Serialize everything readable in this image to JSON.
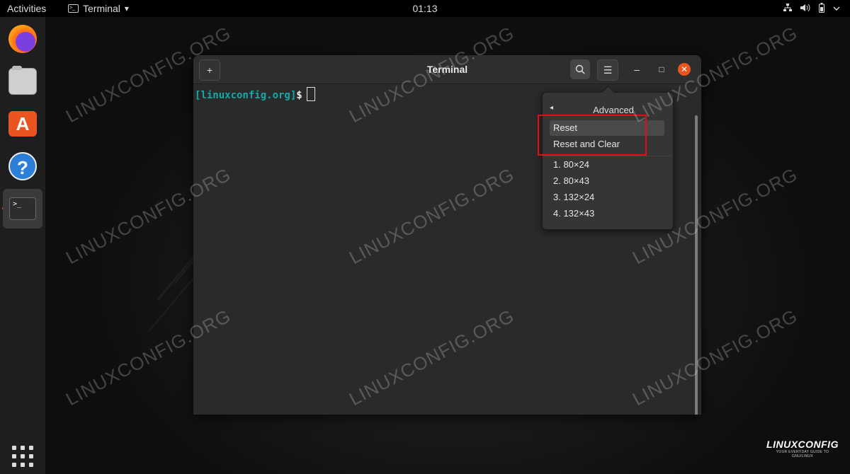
{
  "topbar": {
    "activities": "Activities",
    "app_name": "Terminal",
    "app_dropdown_icon": "▾",
    "clock": "01:13",
    "tray_icons": [
      "network-icon",
      "volume-icon",
      "battery-icon",
      "power-icon"
    ]
  },
  "dock": {
    "items": [
      {
        "name": "Firefox Web Browser",
        "icon": "firefox-icon"
      },
      {
        "name": "Files",
        "icon": "files-icon"
      },
      {
        "name": "Ubuntu Software",
        "icon": "software-icon",
        "glyph": "A"
      },
      {
        "name": "Help",
        "icon": "help-icon",
        "glyph": "?"
      },
      {
        "name": "Terminal",
        "icon": "terminal-icon",
        "glyph": ">_",
        "running": true
      }
    ],
    "show_apps_icon": "app-grid-icon"
  },
  "terminal": {
    "title": "Terminal",
    "prompt_user": "[linuxconfig.org]",
    "prompt_symbol": "$",
    "new_tab_glyph": "+",
    "search_glyph": "⌕",
    "menu_glyph": "☰",
    "minimize_glyph": "–",
    "maximize_glyph": "□",
    "close_glyph": "✕"
  },
  "popover": {
    "back_glyph": "◂",
    "title": "Advanced",
    "items": [
      {
        "label": "Reset"
      },
      {
        "label": "Reset and Clear"
      },
      {
        "label": "1. 80×24"
      },
      {
        "label": "2. 80×43"
      },
      {
        "label": "3. 132×24"
      },
      {
        "label": "4. 132×43"
      }
    ]
  },
  "watermark": "LINUXCONFIG.ORG",
  "logo": {
    "main": "LINUXCONFIG",
    "tagline": "YOUR EVERYDAY GUIDE TO GNU/LINUX"
  },
  "colors": {
    "accent": "#e95420",
    "prompt": "#16a8a8",
    "highlight_box": "#e01010"
  }
}
